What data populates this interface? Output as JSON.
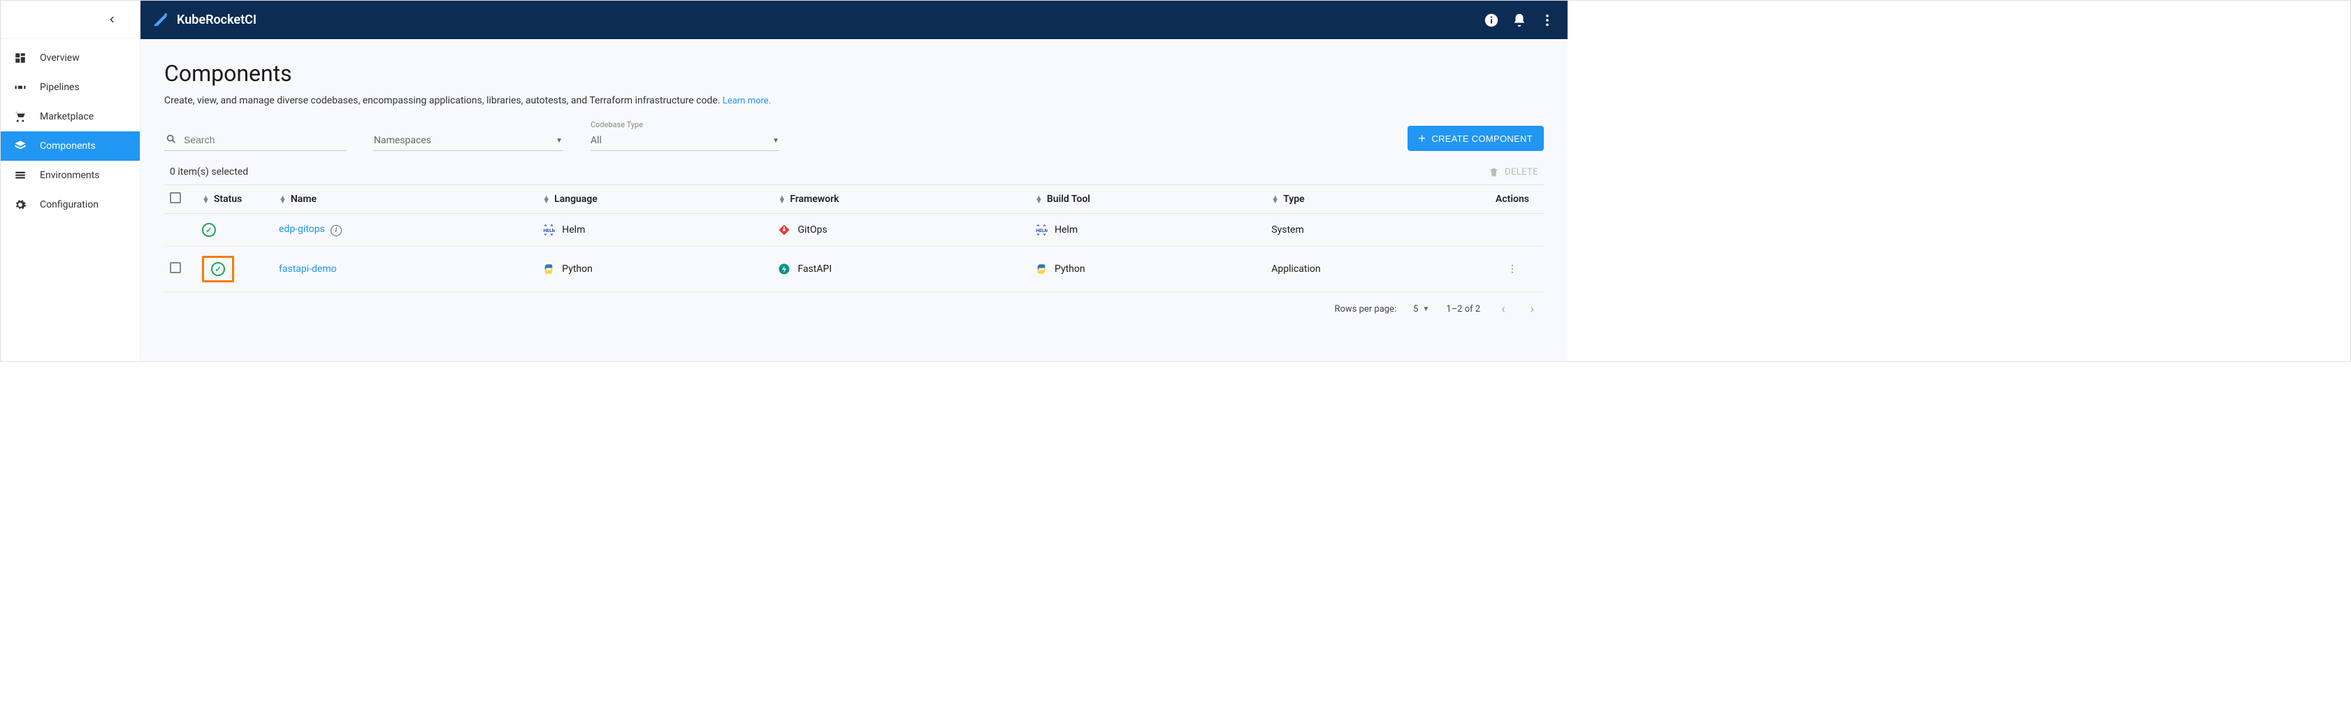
{
  "brand": {
    "name": "KubeRocketCI"
  },
  "sidebar": {
    "items": [
      {
        "label": "Overview",
        "icon": "dashboard-icon"
      },
      {
        "label": "Pipelines",
        "icon": "pipelines-icon"
      },
      {
        "label": "Marketplace",
        "icon": "cart-icon"
      },
      {
        "label": "Components",
        "icon": "layers-icon",
        "active": true
      },
      {
        "label": "Environments",
        "icon": "segments-icon"
      },
      {
        "label": "Configuration",
        "icon": "gear-icon"
      }
    ]
  },
  "page": {
    "title": "Components",
    "subtitle": "Create, view, and manage diverse codebases, encompassing applications, libraries, autotests, and Terraform infrastructure code.",
    "learn_more": "Learn more."
  },
  "filters": {
    "search_placeholder": "Search",
    "namespaces_label": "Namespaces",
    "codebase_type_hint": "Codebase Type",
    "codebase_type_value": "All"
  },
  "actions": {
    "create_label": "CREATE COMPONENT",
    "delete_label": "DELETE"
  },
  "selection": {
    "text": "0 item(s) selected"
  },
  "table": {
    "headers": {
      "status": "Status",
      "name": "Name",
      "language": "Language",
      "framework": "Framework",
      "build_tool": "Build Tool",
      "type": "Type",
      "actions": "Actions"
    },
    "rows": [
      {
        "selectable": false,
        "highlighted": false,
        "status": "ok",
        "name": "edp-gitops",
        "has_info": true,
        "language": "Helm",
        "language_icon": "helm",
        "framework": "GitOps",
        "framework_icon": "gitops",
        "build_tool": "Helm",
        "build_tool_icon": "helm",
        "type": "System",
        "row_actions": false
      },
      {
        "selectable": true,
        "highlighted": true,
        "status": "ok",
        "name": "fastapi-demo",
        "has_info": false,
        "language": "Python",
        "language_icon": "python",
        "framework": "FastAPI",
        "framework_icon": "fastapi",
        "build_tool": "Python",
        "build_tool_icon": "python",
        "type": "Application",
        "row_actions": true
      }
    ]
  },
  "pagination": {
    "rows_label": "Rows per page:",
    "rows_value": "5",
    "range": "1–2 of 2"
  }
}
